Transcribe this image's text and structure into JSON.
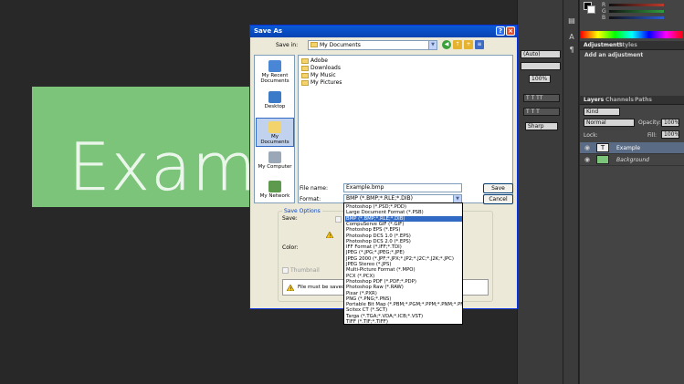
{
  "canvas": {
    "text": "Exam",
    "bg_color": "#7bc47a"
  },
  "dialog": {
    "title": "Save As",
    "save_in_label": "Save in:",
    "save_in_value": "My Documents",
    "places": [
      "My Recent Documents",
      "Desktop",
      "My Documents",
      "My Computer",
      "My Network"
    ],
    "files": [
      "Adobe",
      "Downloads",
      "My Music",
      "My Pictures"
    ],
    "file_name_label": "File name:",
    "file_name_value": "Example.bmp",
    "format_label": "Format:",
    "format_value": "BMP (*.BMP;*.RLE;*.DIB)",
    "save_button": "Save",
    "cancel_button": "Cancel",
    "save_options_legend": "Save Options",
    "save_label": "Save:",
    "color_label": "Color:",
    "thumbnail_label": "Thumbnail",
    "warning_text": "File must be saved as",
    "formats": [
      "Photoshop (*.PSD;*.PDD)",
      "Large Document Format (*.PSB)",
      "BMP (*.BMP;*.RLE;*.DIB)",
      "CompuServe GIF (*.GIF)",
      "Photoshop EPS (*.EPS)",
      "Photoshop DCS 1.0 (*.EPS)",
      "Photoshop DCS 2.0 (*.EPS)",
      "IFF Format (*.IFF;*.TDI)",
      "JPEG (*.JPG;*.JPEG;*.JPE)",
      "JPEG 2000 (*.JPF;*.JPX;*.JP2;*.J2C;*.J2K;*.JPC)",
      "JPEG Stereo (*.JPS)",
      "Multi-Picture Format (*.MPO)",
      "PCX (*.PCX)",
      "Photoshop PDF (*.PDF;*.PDP)",
      "Photoshop Raw (*.RAW)",
      "Pixar (*.PXR)",
      "PNG (*.PNG;*.PNS)",
      "Portable Bit Map (*.PBM;*.PGM;*.PPM;*.PNM;*.PFM",
      "Scitex CT (*.SCT)",
      "Targa (*.TGA;*.VDA;*.ICB;*.VST)",
      "TIFF (*.TIF;*.TIFF)"
    ],
    "selected_format_index": 2
  },
  "options_bar": {
    "auto_value": "(Auto)",
    "percent_value": "100%",
    "sharp_value": "Sharp"
  },
  "panels": {
    "color_labels": [
      "R",
      "G",
      "B"
    ],
    "adjustments_tab": "Adjustments",
    "styles_tab": "Styles",
    "add_adjustment": "Add an adjustment",
    "layers_tab": "Layers",
    "channels_tab": "Channels",
    "paths_tab": "Paths",
    "kind_label": "Kind",
    "blend_mode": "Normal",
    "opacity_label": "Opacity:",
    "opacity_value": "100%",
    "lock_label": "Lock:",
    "fill_label": "Fill:",
    "fill_value": "100%",
    "layers": [
      "Example",
      "Background"
    ],
    "color_sliders": {
      "R": "#c0392b",
      "G": "#2e9e3e",
      "B": "#2a5ad8"
    }
  }
}
